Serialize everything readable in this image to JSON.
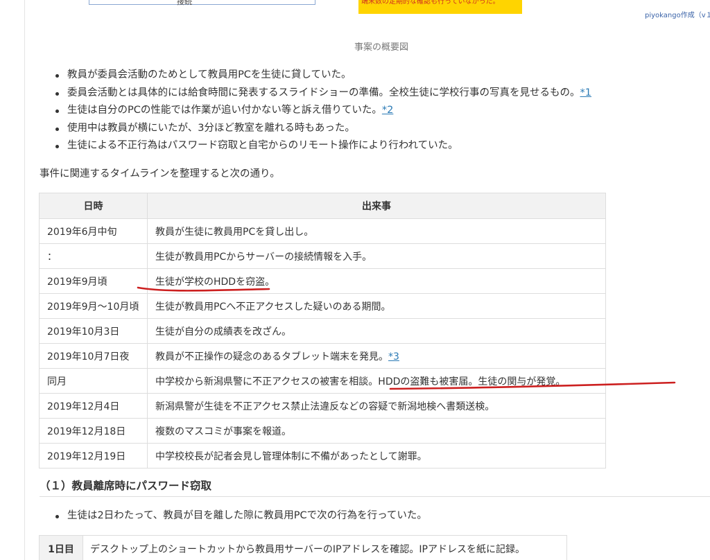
{
  "figure": {
    "left_box_text": "接続",
    "right_box_text": "端末数の定期的な確認も行っていなかった。",
    "credit": "piyokango作成（v１",
    "caption": "事案の概要図"
  },
  "bullets": [
    {
      "text": "教員が委員会活動のためとして教員用PCを生徒に貸していた。",
      "link": ""
    },
    {
      "text": "委員会活動とは具体的には給食時間に発表するスライドショーの準備。全校生徒に学校行事の写真を見せるもの。",
      "link": "*1"
    },
    {
      "text": "生徒は自分のPCの性能では作業が追い付かない等と訴え借りていた。",
      "link": "*2"
    },
    {
      "text": "使用中は教員が横にいたが、3分ほど教室を離れる時もあった。",
      "link": ""
    },
    {
      "text": "生徒による不正行為はパスワード窃取と自宅からのリモート操作により行われていた。",
      "link": ""
    }
  ],
  "intro": "事件に関連するタイムラインを整理すると次の通り。",
  "timeline": {
    "headers": [
      "日時",
      "出来事"
    ],
    "rows": [
      {
        "date": "2019年6月中旬",
        "event": "教員が生徒に教員用PCを貸し出し。",
        "link": ""
      },
      {
        "date": "：",
        "event": "生徒が教員用PCからサーバーの接続情報を入手。",
        "link": ""
      },
      {
        "date": "2019年9月頃",
        "event": "生徒が学校のHDDを窃盗。",
        "link": ""
      },
      {
        "date": "2019年9月～10月頃",
        "event": "生徒が教員用PCへ不正アクセスした疑いのある期間。",
        "link": ""
      },
      {
        "date": "2019年10月3日",
        "event": "生徒が自分の成績表を改ざん。",
        "link": ""
      },
      {
        "date": "2019年10月7日夜",
        "event": "教員が不正操作の疑念のあるタブレット端末を発見。",
        "link": "*3"
      },
      {
        "date": "同月",
        "event": "中学校から新潟県警に不正アクセスの被害を相談。HDDの盗難も被害届。生徒の関与が発覚。",
        "link": ""
      },
      {
        "date": "2019年12月4日",
        "event": "新潟県警が生徒を不正アクセス禁止法違反などの容疑で新潟地検へ書類送検。",
        "link": ""
      },
      {
        "date": "2019年12月18日",
        "event": "複数のマスコミが事案を報道。",
        "link": ""
      },
      {
        "date": "2019年12月19日",
        "event": "中学校校長が記者会見し管理体制に不備があったとして謝罪。",
        "link": ""
      }
    ]
  },
  "section": {
    "heading": "（１）教員離席時にパスワード窃取",
    "bullets": [
      "生徒は2日わたって、教員が目を離した隙に教員用PCで次の行為を行っていた。"
    ],
    "steps": [
      {
        "label": "1日目",
        "text": "デスクトップ上のショートカットから教員用サーバーのIPアドレスを確認。IPアドレスを紙に記録。"
      }
    ]
  },
  "colors": {
    "link": "#2a7ab5",
    "annotation_red": "#cc1f1f",
    "highlight_yellow": "#ffd400",
    "table_header_bg": "#f2f2f2"
  }
}
